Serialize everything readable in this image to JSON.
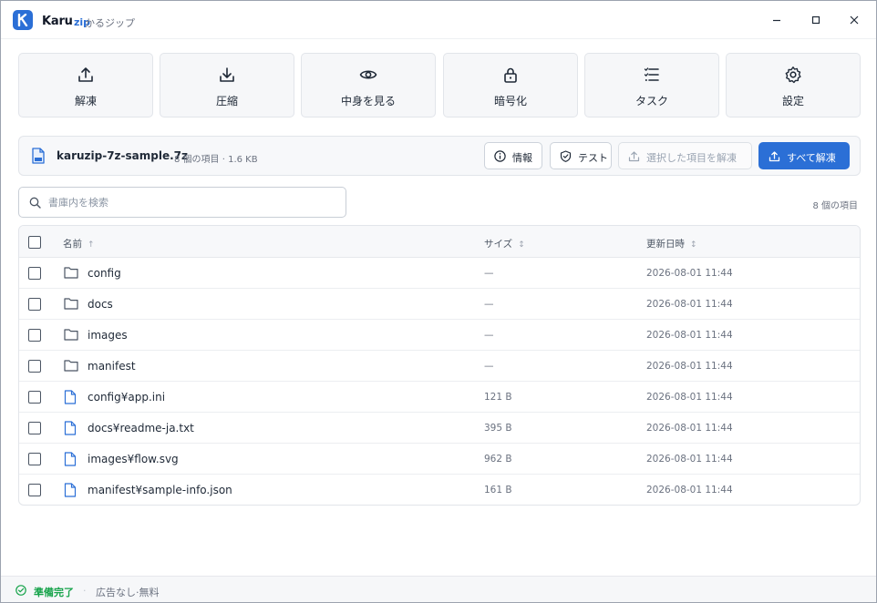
{
  "app": {
    "name": "Karu",
    "name_suffix": "zip",
    "subtitle": "かるジップ",
    "colors": {
      "accent": "#2b6fd6",
      "ready": "#16a34a"
    }
  },
  "window_controls": [
    "minimize-icon",
    "maximize-icon",
    "close-icon"
  ],
  "toolbar": {
    "extract": "解凍",
    "compress": "圧縮",
    "view": "中身を見る",
    "encrypt": "暗号化",
    "tasks": "タスク",
    "settings": "設定"
  },
  "archive": {
    "name": "karuzip-7z-sample.7z",
    "meta": "8 個の項目 · 1.6 KB",
    "buttons": {
      "info": "情報",
      "test": "テスト",
      "extract_selected": "選択した項目を解凍",
      "extract_all": "すべて解凍"
    }
  },
  "search": {
    "placeholder": "書庫内を検索",
    "value": ""
  },
  "item_count": "8 個の項目",
  "table": {
    "columns": {
      "name": "名前",
      "name_sort": "↑",
      "size": "サイズ",
      "size_sort": "↕",
      "modified": "更新日時",
      "modified_sort": "↕"
    },
    "rows": [
      {
        "name": "config",
        "type": "folder",
        "size": "—",
        "modified": "2026-08-01 11:44",
        "checked": false
      },
      {
        "name": "docs",
        "type": "folder",
        "size": "—",
        "modified": "2026-08-01 11:44",
        "checked": false
      },
      {
        "name": "images",
        "type": "folder",
        "size": "—",
        "modified": "2026-08-01 11:44",
        "checked": false
      },
      {
        "name": "manifest",
        "type": "folder",
        "size": "—",
        "modified": "2026-08-01 11:44",
        "checked": false
      },
      {
        "name": "config¥app.ini",
        "type": "file",
        "size": "121 B",
        "modified": "2026-08-01 11:44",
        "checked": false
      },
      {
        "name": "docs¥readme-ja.txt",
        "type": "file",
        "size": "395 B",
        "modified": "2026-08-01 11:44",
        "checked": false
      },
      {
        "name": "images¥flow.svg",
        "type": "file",
        "size": "962 B",
        "modified": "2026-08-01 11:44",
        "checked": false
      },
      {
        "name": "manifest¥sample-info.json",
        "type": "file",
        "size": "161 B",
        "modified": "2026-08-01 11:44",
        "checked": false
      }
    ]
  },
  "status": {
    "ready": "準備完了",
    "separator": "·",
    "note": "広告なし·無料"
  }
}
